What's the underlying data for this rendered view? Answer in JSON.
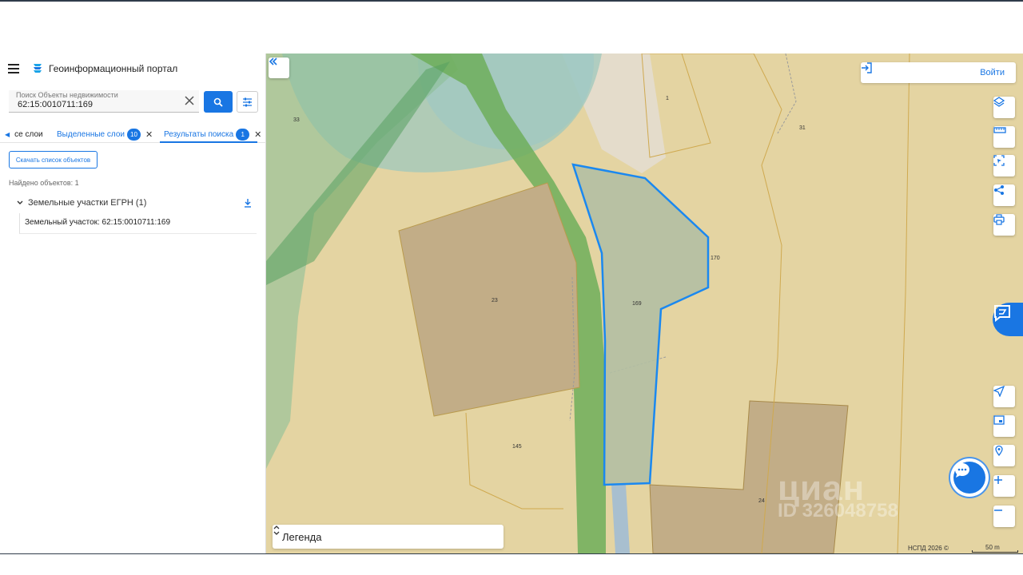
{
  "app": {
    "title": "Геоинформационный портал"
  },
  "search": {
    "placeholder": "Поиск Объекты недвижимости",
    "value": "62:15:0010711:169"
  },
  "tabs": [
    {
      "label": "се слои",
      "badge": "",
      "active": false
    },
    {
      "label": "Выделенные слои",
      "badge": "10",
      "active": false
    },
    {
      "label": "Результаты поиска",
      "badge": "1",
      "active": true
    }
  ],
  "results": {
    "download_list_label": "Скачать список объектов",
    "found_label": "Найдено объектов: 1",
    "group_label": "Земельные участки ЕГРН (1)",
    "item_label": "Земельный участок: 62:15:0010711:169"
  },
  "map": {
    "login_label": "Войти",
    "legend_label": "Легенда",
    "attribution": "НСПД 2026 ©",
    "scale_label": "50 m",
    "parcel_labels": [
      "33",
      "1",
      "31",
      "170",
      "169",
      "23",
      "145",
      "24"
    ],
    "selected_parcel": "169",
    "watermark": {
      "brand": "циан",
      "id": "ID 326048758"
    },
    "colors": {
      "selected_outline": "#1a88f0",
      "accent": "#1976e3",
      "parcel_fill": "#c2ad87",
      "base": "#e4d4a2",
      "forest": "#7fb98f",
      "water": "#9fc8cc"
    }
  },
  "icons": {
    "menu": "menu-icon",
    "logo": "logo-icon",
    "clear": "close-icon",
    "search": "search-icon",
    "filter": "filter-icon",
    "collapse": "double-chevron-left-icon",
    "login": "login-icon",
    "layers": "layers-icon",
    "ruler": "ruler-icon",
    "select_area": "select-area-icon",
    "share": "share-icon",
    "print": "print-icon",
    "locate": "navigation-arrow-icon",
    "minimap": "minimap-icon",
    "place": "place-search-icon",
    "zoom_in": "plus-icon",
    "zoom_out": "minus-icon",
    "chat": "chat-icon"
  }
}
